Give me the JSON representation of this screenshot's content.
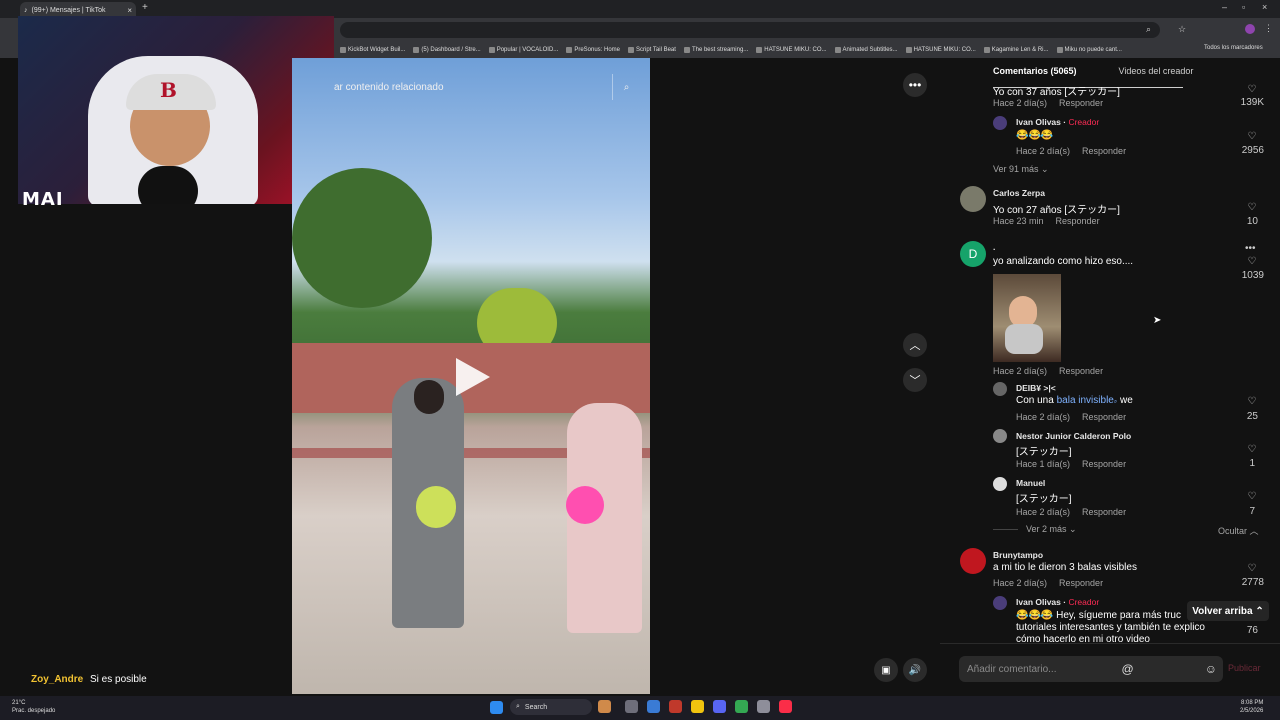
{
  "browser": {
    "tab_title": "(99+) Mensajes | TikTok",
    "new_tab": "+",
    "all_bookmarks": "Todos los marcadores",
    "bookmarks": [
      "KickBot Widget Buil...",
      "(5) Dashboard / Stre...",
      "Popular | VOCALOID...",
      "PreSonus: Home",
      "Script Tail Beat",
      "The best streaming...",
      "HATSUNE MIKU: CO...",
      "Animated Subtitles...",
      "HATSUNE MIKU: CO...",
      "Kagamine Len & Ri...",
      "Miku no puede cant..."
    ]
  },
  "stream": {
    "overlay_name": "MAI",
    "chat": {
      "user": "Zoy_Andre",
      "message": "Si es posible"
    }
  },
  "video": {
    "search_placeholder": "ar contenido relacionado"
  },
  "comments": {
    "tab_comments": "Comentarios (5065)",
    "tab_creator_videos": "Videos del creador",
    "reply_label": "Responder",
    "items": {
      "c0": {
        "text": "Yo con 37 años [ステッカー]",
        "time": "Hace 2 día(s)",
        "likes": "139K"
      },
      "c0r1": {
        "name": "Ivan Olivas",
        "badge": "Creador",
        "text": "😂😂😂",
        "time": "Hace 2 día(s)",
        "likes": "2956"
      },
      "c0more": "Ver 91 más",
      "c1": {
        "name": "Carlos Zerpa",
        "text": "Yo con 27 años [ステッカー]",
        "time": "Hace 23 min",
        "likes": "10"
      },
      "c2": {
        "avatar_letter": "D",
        "name": ".",
        "text": "yo analizando como hizo eso....",
        "time": "Hace 2 día(s)",
        "likes": "1039"
      },
      "c2r1": {
        "name": "DEIB¥ >|<",
        "text_pre": "Con una ",
        "link": "bala invisible",
        "text_post": " we",
        "time": "Hace 2 día(s)",
        "likes": "25"
      },
      "c2r2": {
        "name": "Nestor Junior Calderon Polo",
        "text": "[ステッカー]",
        "time": "Hace 1 día(s)",
        "likes": "1"
      },
      "c2r3": {
        "name": "Manuel",
        "text": "[ステッカー]",
        "time": "Hace 2 día(s)",
        "likes": "7"
      },
      "c2more": "Ver 2 más",
      "c2hide": "Ocultar",
      "c3": {
        "name": "Brunytampo",
        "text": "a mi tio le dieron 3 balas visibles",
        "time": "Hace 2 día(s)",
        "likes": "2778"
      },
      "c3r1": {
        "name": "Ivan Olivas",
        "badge": "Creador",
        "text1": "😂😂😂 Hey, sígueme para más truc",
        "text2": "tutoriales interesantes y también te explico",
        "text3": "cómo hacerlo en mi otro video",
        "likes": "76"
      }
    },
    "back_to_top": "Volver arriba",
    "add_comment_placeholder": "Añadir comentario...",
    "publish": "Publicar"
  },
  "taskbar": {
    "temp": "21°C",
    "weather": "Prac. despejado",
    "search": "Search",
    "time": "8:08 PM",
    "date": "2/5/2026"
  }
}
